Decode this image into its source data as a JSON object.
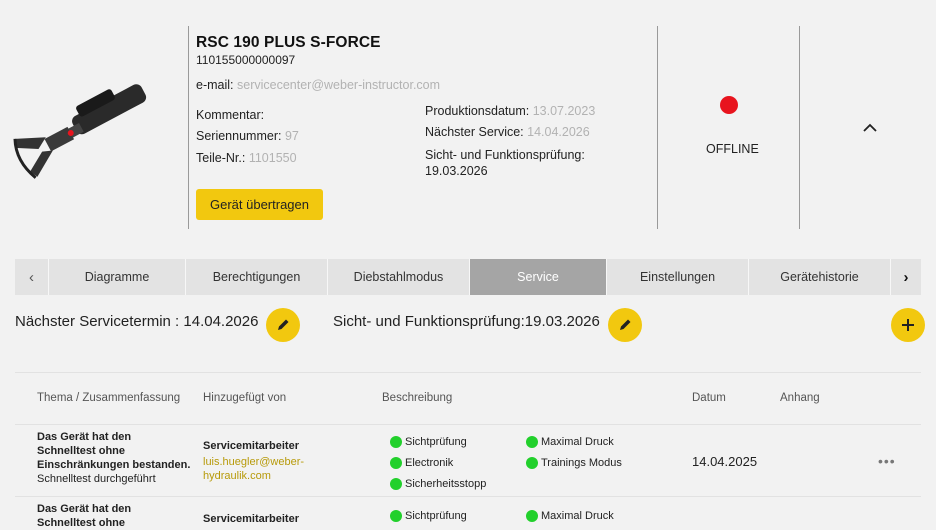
{
  "device": {
    "name": "RSC 190 PLUS S-FORCE",
    "number": "110155000000097",
    "email_label": "e-mail:",
    "email_value": "servicecenter@weber-instructor.com",
    "comment_label": "Kommentar:",
    "serial_label": "Seriennummer:",
    "serial_value": "97",
    "parts_label": "Teile-Nr.:",
    "parts_value": "1101550",
    "production_label": "Produktionsdatum:",
    "production_value": "13.07.2023",
    "next_service_label": "Nächster Service:",
    "next_service_value": "14.04.2026",
    "inspection_label": "Sicht- und Funktionsprüfung:",
    "inspection_value": "19.03.2026",
    "transfer_button": "Gerät übertragen",
    "status_text": "OFFLINE",
    "status_color": "#e8141e",
    "image_icon": "hydraulic-cutter"
  },
  "tabs": [
    {
      "label": "Diagramme",
      "active": false
    },
    {
      "label": "Berechtigungen",
      "active": false
    },
    {
      "label": "Diebstahlmodus",
      "active": false
    },
    {
      "label": "Service",
      "active": true
    },
    {
      "label": "Einstellungen",
      "active": false
    },
    {
      "label": "Gerätehistorie",
      "active": false
    }
  ],
  "service": {
    "next_service_text": "Nächster Servicetermin : 14.04.2026",
    "inspection_text": "Sicht- und Funktionsprüfung:19.03.2026",
    "accent_color": "#f2c80f"
  },
  "table": {
    "headers": [
      "Thema / Zusammenfassung",
      "Hinzugefügt von",
      "Beschreibung",
      "Datum",
      "Anhang"
    ],
    "rows": [
      {
        "title_line1": "Das Gerät hat den",
        "title_line2": "Schnelltest ohne",
        "title_line3": "Einschränkungen bestanden.",
        "summary": "Schnelltest durchgeführt",
        "added_role": "Servicemitarbeiter",
        "added_email_line1": "luis.huegler@weber-",
        "added_email_line2": "hydraulik.com",
        "checks_left": [
          "Sichtprüfung",
          "Electronik",
          "Sicherheitsstopp"
        ],
        "checks_right": [
          "Maximal Druck",
          "Trainings Modus"
        ],
        "date": "14.04.2025",
        "more": "•••"
      },
      {
        "title_line1": "Das Gerät hat den",
        "title_line2": "Schnelltest ohne",
        "added_role": "Servicemitarbeiter",
        "checks_left": [
          "Sichtprüfung"
        ],
        "checks_right": [
          "Maximal Druck"
        ]
      }
    ]
  }
}
